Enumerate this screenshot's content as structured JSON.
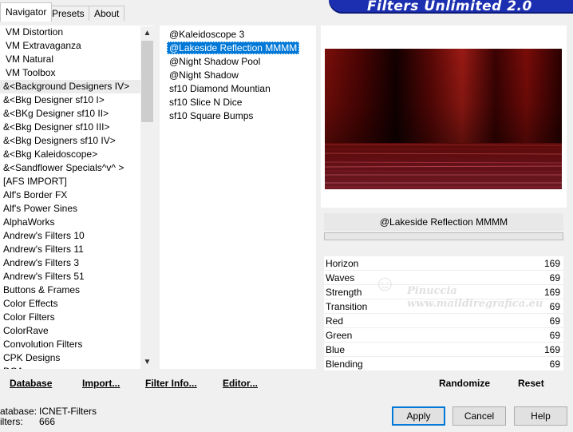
{
  "tabs": [
    {
      "label": "Navigator",
      "active": true
    },
    {
      "label": "Presets",
      "active": false
    },
    {
      "label": "About",
      "active": false
    }
  ],
  "banner_title": "Filters Unlimited 2.0",
  "categories": [
    "VM Distortion",
    "VM Extravaganza",
    "VM Natural",
    "VM Toolbox",
    "&<Background Designers IV>",
    "&<Bkg Designer sf10 I>",
    "&<BKg Designer sf10 II>",
    "&<Bkg Designer sf10 III>",
    "&<Bkg Designers sf10 IV>",
    "&<Bkg Kaleidoscope>",
    "&<Sandflower Specials^v^ >",
    "[AFS IMPORT]",
    "Alf's Border FX",
    "Alf's Power Sines",
    "AlphaWorks",
    "Andrew's Filters 10",
    "Andrew's Filters 11",
    "Andrew's Filters 3",
    "Andrew's Filters 51",
    "Buttons & Frames",
    "Color Effects",
    "Color Filters",
    "ColorRave",
    "Convolution Filters",
    "CPK Designs",
    "DCA"
  ],
  "selected_category_index": 4,
  "filters": [
    "@Kaleidoscope 3",
    "@Lakeside Reflection MMMM",
    "@Night Shadow Pool",
    "@Night Shadow",
    "sf10 Diamond Mountian",
    "sf10 Slice N Dice",
    "sf10 Square Bumps"
  ],
  "selected_filter_index": 1,
  "selected_filter_name": "@Lakeside Reflection MMMM",
  "params": [
    {
      "name": "Horizon",
      "value": "169"
    },
    {
      "name": "Waves",
      "value": "69"
    },
    {
      "name": "Strength",
      "value": "169"
    },
    {
      "name": "Transition",
      "value": "69"
    },
    {
      "name": "Red",
      "value": "69"
    },
    {
      "name": "Green",
      "value": "69"
    },
    {
      "name": "Blue",
      "value": "169"
    },
    {
      "name": "Blending",
      "value": "69"
    }
  ],
  "watermark": {
    "line1": "Pinuccia",
    "line2": "www.maildiregrafica.eu"
  },
  "buttons": {
    "database": "Database",
    "import": "Import...",
    "filter_info": "Filter Info...",
    "editor": "Editor...",
    "randomize": "Randomize",
    "reset": "Reset",
    "apply": "Apply",
    "cancel": "Cancel",
    "help": "Help"
  },
  "status": {
    "database_label": "atabase:",
    "database_value": "ICNET-Filters",
    "filters_label": "ilters:",
    "filters_value": "666"
  },
  "colors": {
    "selection": "#0078d7",
    "banner": "#1b2fb0",
    "preview_dark": "#3a0404",
    "preview_red": "#9a1a14"
  }
}
